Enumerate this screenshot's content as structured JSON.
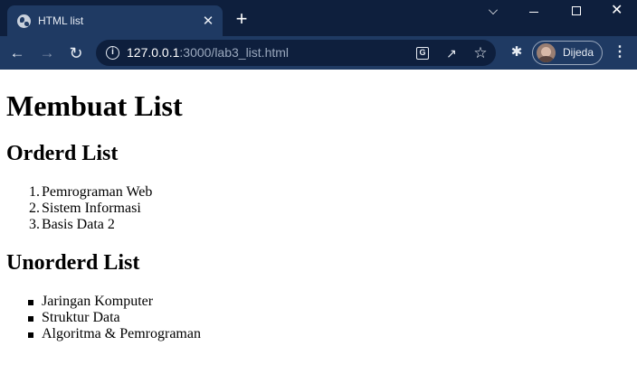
{
  "browser": {
    "tab_title": "HTML list",
    "tab_close": "✕",
    "new_tab": "+",
    "url_host": "127.0.0.1",
    "url_path": ":3000/lab3_list.html",
    "profile_name": "Dijeda",
    "icons": {
      "back": "arrow-left",
      "forward": "arrow-right",
      "reload": "reload",
      "site_info": "info",
      "translate": "translate",
      "share": "share",
      "bookmark": "star",
      "extensions": "puzzle",
      "menu": "kebab"
    },
    "colors": {
      "titlebar": "#0e1f3d",
      "toolbar": "#1f3a63",
      "omnibox": "#0e1f3d"
    }
  },
  "page": {
    "title": "Membuat List",
    "ordered_heading": "Orderd List",
    "ordered_items": [
      {
        "num": "1.",
        "label": "Pemrograman Web"
      },
      {
        "num": "2.",
        "label": "Sistem Informasi"
      },
      {
        "num": "3.",
        "label": "Basis Data 2"
      }
    ],
    "unordered_heading": "Unorderd List",
    "unordered_items": [
      {
        "label": "Jaringan Komputer"
      },
      {
        "label": "Struktur Data"
      },
      {
        "label": "Algoritma & Pemrograman"
      }
    ]
  }
}
